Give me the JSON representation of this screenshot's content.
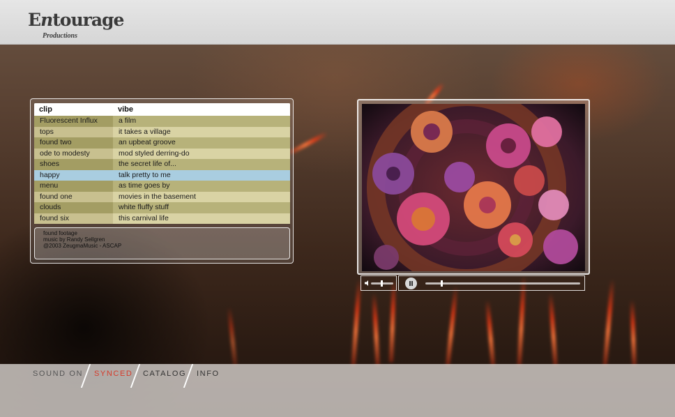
{
  "brand": {
    "title_initial": "E",
    "title_middle": "n",
    "title_rest": "tourage",
    "subtitle": "Productions"
  },
  "playlist": {
    "columns": [
      "clip",
      "vibe"
    ],
    "rows": [
      {
        "clip": "Fluorescent Influx",
        "vibe": "a film"
      },
      {
        "clip": "tops",
        "vibe": "it takes a village"
      },
      {
        "clip": "found two",
        "vibe": "an upbeat groove"
      },
      {
        "clip": "ode to modesty",
        "vibe": "mod styled derring-do"
      },
      {
        "clip": "shoes",
        "vibe": "the secret life of..."
      },
      {
        "clip": "happy",
        "vibe": "talk pretty to me"
      },
      {
        "clip": "menu",
        "vibe": "as time goes by"
      },
      {
        "clip": "found one",
        "vibe": "movies in the basement"
      },
      {
        "clip": "clouds",
        "vibe": "white fluffy stuff"
      },
      {
        "clip": "found six",
        "vibe": "this carnival life"
      }
    ],
    "selected_index": 5
  },
  "credits": [
    "found footage",
    "music by Randy Sellgren",
    "@2003 ZeugmaMusic - ASCAP"
  ],
  "player": {
    "state": "playing",
    "volume": 0.45,
    "progress": 0.1,
    "icons": [
      "speaker-icon",
      "pause-icon"
    ]
  },
  "nav": {
    "sound": "SOUND ON",
    "synced": "SYNCED",
    "catalog": "CATALOG",
    "info": "INFO"
  },
  "colors": {
    "accent": "#d63a2a",
    "row_selected": "#a9cde0",
    "row_dark": "#a39d63",
    "row_light": "#d9d3a4"
  }
}
